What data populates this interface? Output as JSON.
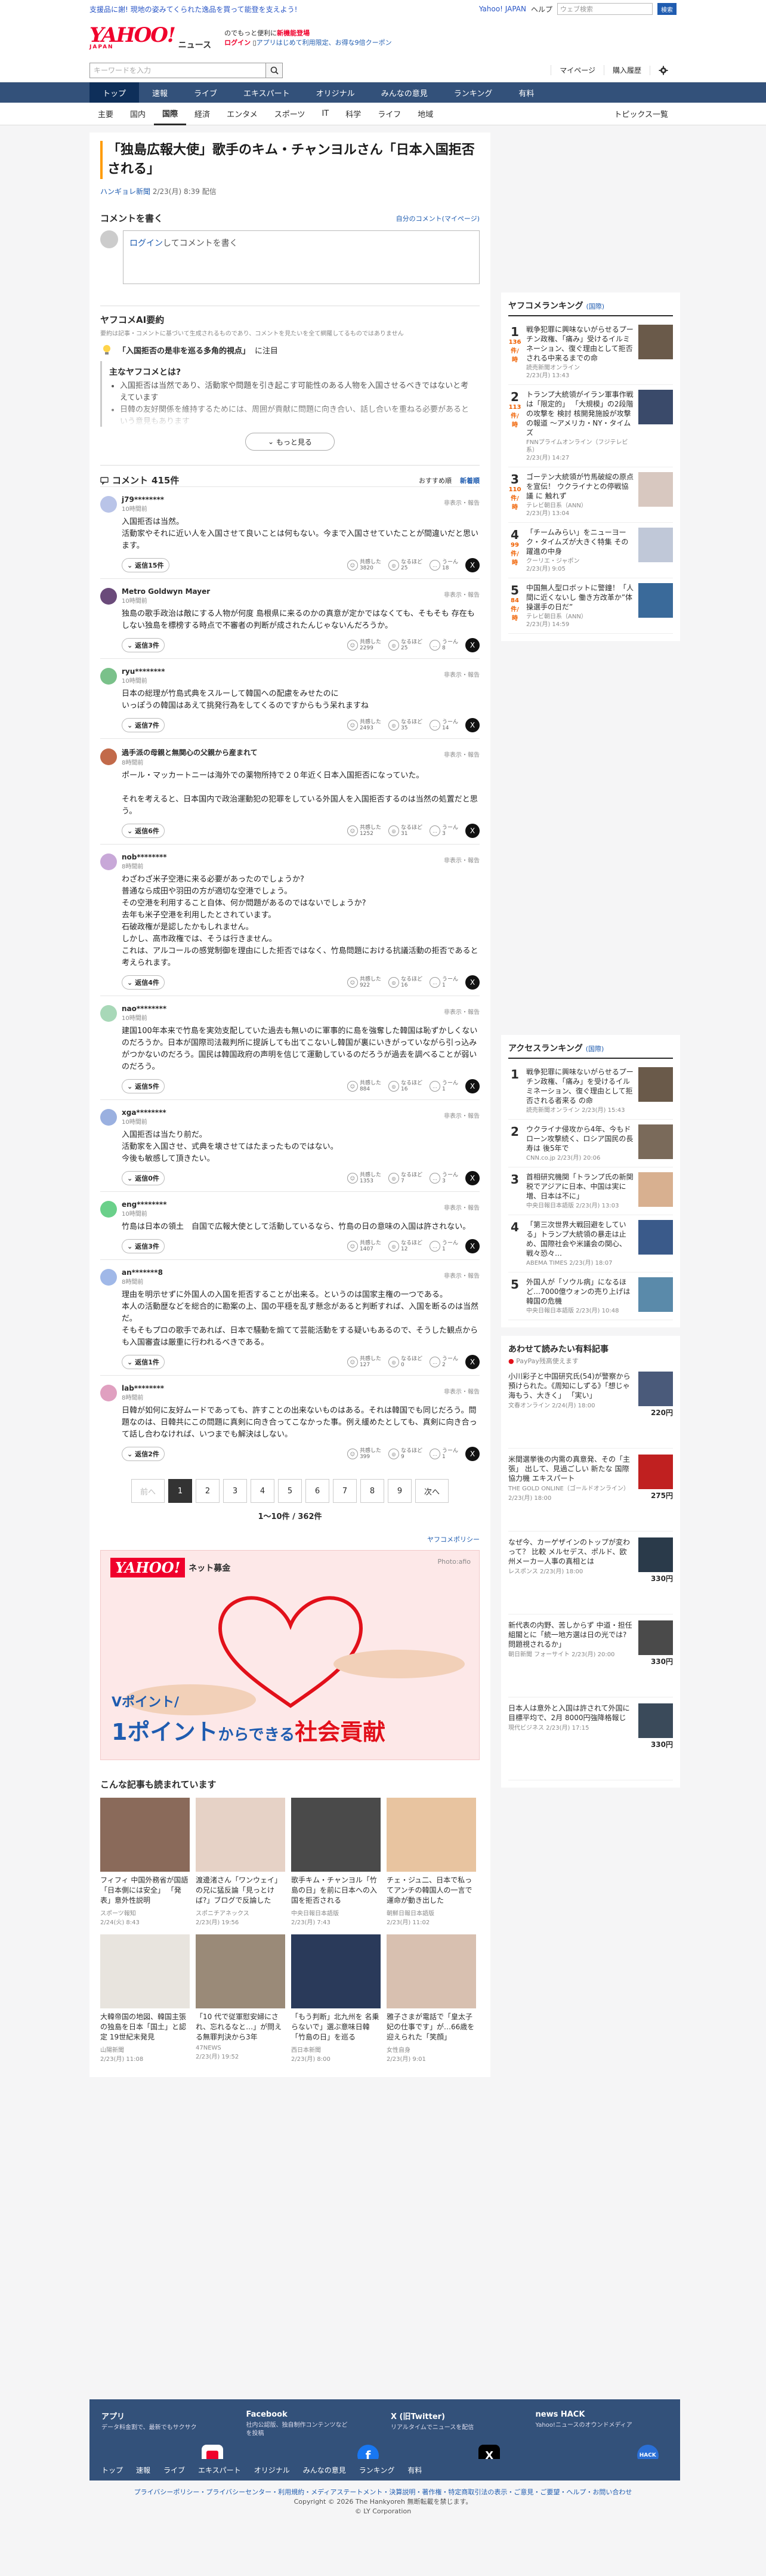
{
  "promo_bar": {
    "left": "支援品に謝! 現地の姿みてくられた逸品を買って能登を支えよう!",
    "links": [
      "Yahoo! JAPAN",
      "ヘルプ"
    ],
    "search_placeholder": "ウェブ検索",
    "search_button": "検索"
  },
  "header": {
    "logo": "YAHOO!",
    "logo_sub": "JAPAN",
    "service": "ニュース",
    "promo_line1a": "のでもっと便利に",
    "promo_line1b": "新機能登場",
    "promo_line2a": "ログイン",
    "promo_line2b": "アプリはじめて利用限定、お得な9倍クーポン"
  },
  "search": {
    "placeholder": "キーワードを入力",
    "links": [
      "マイページ",
      "購入履歴"
    ]
  },
  "gnav": [
    "トップ",
    "速報",
    "ライブ",
    "エキスパート",
    "オリジナル",
    "みんなの意見",
    "ランキング",
    "有料"
  ],
  "subnav": {
    "items": [
      "主要",
      "国内",
      "国際",
      "経済",
      "エンタメ",
      "スポーツ",
      "IT",
      "科学",
      "ライフ",
      "地域"
    ],
    "active": 2,
    "topics": "トピックス一覧"
  },
  "article": {
    "title": "「独島広報大使」歌手のキム・チャンヨルさん「日本入国拒否される」",
    "source": "ハンギョレ新聞",
    "date": "2/23(月) 8:39",
    "source_suffix": "配信"
  },
  "comment_form": {
    "title": "コメントを書く",
    "link": "自分のコメント(マイページ)",
    "login": "ログイン",
    "rest": "してコメントを書く"
  },
  "ai_summary": {
    "title": "ヤフコメAI要約",
    "note": "要約は記事・コメントに基づいて生成されるものであり、コメントを見たいを全て網羅してるものではありません",
    "topic": "「入国拒否の是非を巡る多角的視点」",
    "topic_suffix": "に注目",
    "question": "主なヤフコメとは?",
    "points": [
      "入国拒否は当然であり、活動家や問題を引き起こす可能性のある人物を入国させるべきではないと考えています",
      "日韓の友好関係を維持するためには、周囲が貢献に問題に向き合い、話し合いを重ねる必要があるという意見もあります"
    ],
    "more": "もっと見る"
  },
  "comments_header": {
    "title": "コメント",
    "count": "415件",
    "sort_recommended": "おすすめ順",
    "sort_new": "新着順"
  },
  "comments": [
    {
      "name": "j79********",
      "time": "10時間前",
      "body": "入国拒否は当然。\n活動家やそれに近い人を入国させて良いことは何もない。今まで入国させていたことが間違いだと思います。",
      "replies": "返信15件",
      "r1": "3820",
      "r2": "25",
      "r3": "18",
      "avatar": "#b9c4e8"
    },
    {
      "name": "Metro Goldwyn Mayer",
      "time": "10時間前",
      "body": "独島の歌手政治は敵にする人物が何度 島根県に来るのかの真意が定かではなくても、そもそも 存在もしない独島を標榜する時点で不審者の判断が成されたんじゃないんだろうか。",
      "replies": "返信3件",
      "r1": "2299",
      "r2": "25",
      "r3": "8",
      "avatar": "#6a4a7a"
    },
    {
      "name": "ryu********",
      "time": "10時間前",
      "body": "日本の総理が竹島式典をスルーして韓国への配慮をみせたのに\nいっぽうの韓国はあえて挑発行為をしてくるのですからもう呆れますね",
      "replies": "返信7件",
      "r1": "2493",
      "r2": "35",
      "r3": "14",
      "avatar": "#7ac18a"
    },
    {
      "name": "過手派の母親と無関心の父親から産まれて",
      "time": "8時間前",
      "body": "ポール・マッカートニーは海外での薬物所持で２０年近く日本入国拒否になっていた。\n\nそれを考えると、日本国内で政治運動犯の犯罪をしている外国人を入国拒否するのは当然の処置だと思う。",
      "replies": "返信6件",
      "r1": "1252",
      "r2": "31",
      "r3": "3",
      "avatar": "#c26a4a"
    },
    {
      "name": "nob********",
      "time": "8時間前",
      "body": "わざわざ米子空港に来る必要があったのでしょうか?\n普通なら成田や羽田の方が適切な空港でしょう。\nその空港を利用すること自体、何か問題があるのではないでしょうか?\n去年も米子空港を利用したとされています。\n石破政権が是認したかもしれません。\nしかし、高市政権では、そうは行きません。\nこれは、アルコールの感覚制御を理由にした拒否ではなく、竹島問題における抗議活動の拒否であると考えられます。",
      "replies": "返信4件",
      "r1": "922",
      "r2": "16",
      "r3": "1",
      "avatar": "#c8a8d8"
    },
    {
      "name": "nao********",
      "time": "10時間前",
      "body": "建国100年本来で竹島を実効支配していた過去も無いのに軍事的に島を強奪した韓国は恥ずかしくないのだろうか。日本が国際司法裁判所に提訴しても出てこないし韓国が裏にいきがっていながら引っ込みがつかないのだろう。国民は韓国政府の声明を信じて運動しているのだろうが過去を調べることが弱いのだろう。",
      "replies": "返信5件",
      "r1": "884",
      "r2": "16",
      "r3": "1",
      "avatar": "#a8d8b8"
    },
    {
      "name": "xga********",
      "time": "10時間前",
      "body": "入国拒否は当たり前だ。\n活動家を入国させ、式典を壊させてはたまったものではない。\n今後も敏感して頂きたい。",
      "replies": "返信0件",
      "r1": "1353",
      "r2": "7",
      "r3": "3",
      "avatar": "#9ab0e0"
    },
    {
      "name": "eng********",
      "time": "10時間前",
      "body": "竹島は日本の領土　自国で広報大使として活動しているなら、竹島の日の意味の入国は許されない。",
      "replies": "返信3件",
      "r1": "1407",
      "r2": "12",
      "r3": "1",
      "avatar": "#6ad08a"
    },
    {
      "name": "an*******8",
      "time": "8時間前",
      "body": "理由を明示せずに外国人の入国を拒否することが出来る。というのは国家主権の一つである。\n本人の活動歴などを総合的に勘案の上、国の平穏を乱す懸念があると判断すれば、入国を断るのは当然だ。\nそもそもプロの歌手であれば、日本で騒動を煽てて芸能活動をする疑いもあるので、そうした観点からも入国審査は厳重に行われるべきである。",
      "replies": "返信1件",
      "r1": "127",
      "r2": "0",
      "r3": "2",
      "avatar": "#a0b8e8"
    },
    {
      "name": "lab********",
      "time": "8時間前",
      "body": "日韓が如何に友好ムードであっても、許すことの出来ないものはある。それは韓国でも同じだろう。問題なのは、日韓共にこの問題に真剣に向き合ってこなかった事。例え緩めたとしても、真剣に向き合って話し合わなければ、いつまでも解決はしない。",
      "replies": "返信2件",
      "r1": "399",
      "r2": "9",
      "r3": "1",
      "avatar": "#e0a0c0"
    }
  ],
  "reaction_labels": {
    "r1": "共感した",
    "r2": "なるほど",
    "r3": "うーん"
  },
  "flag_label": "非表示・報告",
  "pager": {
    "prev": "前へ",
    "pages": [
      "1",
      "2",
      "3",
      "4",
      "5",
      "6",
      "7",
      "8",
      "9"
    ],
    "next": "次へ",
    "count": "1〜10件 / 362件"
  },
  "policy_link": "ヤフコメポリシー",
  "ad": {
    "logo": "YAHOO!",
    "logo_sub": "JAPAN",
    "service": "ネット募金",
    "photo": "Photo:afio",
    "copy1": "Vポイント/",
    "copy2a": "1ポイント",
    "copy2b": "からできる",
    "copy2c": "社会貢献"
  },
  "recommended": {
    "title": "こんな記事も読まれています",
    "items": [
      {
        "title": "フィフィ 中国外務省が国語「日本側には安全」 「発表」意外性説明",
        "src": "スポーツ報知",
        "date": "2/24(火) 8:43",
        "color": "#8a6a5a"
      },
      {
        "title": "渡邊渚さん「ワンウェイ」の兄に猛反論「見っとけば?」ブログで反論した",
        "src": "スポニチアネックス",
        "date": "2/23(月) 19:56",
        "color": "#e6d2c6"
      },
      {
        "title": "歌手キム・チャンヨル「竹島の日」を前に日本への入国を拒否される",
        "src": "中央日報日本語版",
        "date": "2/23(月) 7:43",
        "color": "#4a4a4a"
      },
      {
        "title": "チェ・ジュ二、日本で私ってアンチの韓国人の一言で運命が動き出した",
        "src": "朝鮮日報日本語版",
        "date": "2/23(月) 11:02",
        "color": "#e8c4a0"
      },
      {
        "title": "大韓帝国の地図、韓国主張の独島を日本「国土」と認定 19世紀末発見",
        "src": "山陽新聞",
        "date": "2/23(月) 11:08",
        "color": "#e8e4de"
      },
      {
        "title": "「10 代で従軍慰安婦にされ、忘れるなと…」が問える無罪判決から3年",
        "src": "47NEWS",
        "date": "2/23(月) 19:52",
        "color": "#9a8a78"
      },
      {
        "title": "「もう判断」北九州を 名乗らないで」選ぶ意味日韓「竹島の日」を巡る",
        "src": "西日本新聞",
        "date": "2/23(月) 8:00",
        "color": "#2a3a5a"
      },
      {
        "title": "雅子さまが電話で「皇太子妃の仕事です」が…66歳を迎えられた「笑顔」",
        "src": "女性自身",
        "date": "2/23(月) 9:01",
        "color": "#d8c0b0"
      }
    ]
  },
  "ranking": {
    "title": "ヤフコメランキング",
    "sub": "(国際)",
    "items": [
      {
        "rank": "1",
        "count": "136",
        "unit": "件/時",
        "title": "戦争犯罪に興味ないがらせるプーチン政権、「痛み」受けるイルミネーション、復ぐ理由として拒否される中来るまでの命",
        "src": "読売新聞オンライン",
        "date": "2/23(月) 13:43",
        "color": "#6a5a4a"
      },
      {
        "rank": "2",
        "count": "113",
        "unit": "件/時",
        "title": "トランプ大統領がイラン軍事作戦は「限定的」 「大規模」の2段階の攻撃を 検討 核開発施設が攻撃の報道 ～アメリカ・NY・タイムズ",
        "src": "FNNプライムオンライン（フジテレビ系）",
        "date": "2/23(月) 14:27",
        "color": "#3a4a6a"
      },
      {
        "rank": "3",
        "count": "110",
        "unit": "件/時",
        "title": "ゴーテン大統領が竹馬破綻の原点を宣伝！ ウクライナとの停戦協議 に 触れず",
        "src": "テレビ朝日系（ANN）",
        "date": "2/23(月) 13:04",
        "color": "#d8c8c0"
      },
      {
        "rank": "4",
        "count": "99",
        "unit": "件/時",
        "title": "「チームみらい」をニューヨーク・タイムズが大きく特集 その躍進の中身",
        "src": "クーリエ・ジャポン",
        "date": "2/23(月) 9:05",
        "color": "#c0c8d8"
      },
      {
        "rank": "5",
        "count": "84",
        "unit": "件/時",
        "title": "中国無人型ロボットに警鐘！「人間に近くないし 働き方改革か”体操選手の日だ”",
        "src": "テレビ朝日系（ANN）",
        "date": "2/23(月) 14:59",
        "color": "#3a6a9a"
      }
    ]
  },
  "access_ranking": {
    "title": "アクセスランキング",
    "sub": "(国際)",
    "items": [
      {
        "rank": "1",
        "title": "戦争犯罪に興味ないがらせるプーチン政権、「痛み」を受けるイルミネーション、復ぐ理由として拒否される者来る の命",
        "src": "読売新聞オンライン 2/23(月) 15:43",
        "color": "#6a5a4a"
      },
      {
        "rank": "2",
        "title": "ウクライナ侵攻から4年、今もドローン攻撃続く、ロシア国民の長寿は 後5年で",
        "src": "CNN.co.jp 2/23(月) 20:06",
        "color": "#7a6a5a"
      },
      {
        "rank": "3",
        "title": "首相研究機関「トランプ氏の新関税でアジアに日本、中国は実に増、日本は不に」",
        "src": "中央日報日本語版 2/23(月) 13:03",
        "color": "#d8b090"
      },
      {
        "rank": "4",
        "title": "「第三次世界大戦回避をしている」トランプ大統領の暴走は止め、国際社会や米議会の関心、戦々恐々…",
        "src": "ABEMA TIMES 2/23(月) 18:07",
        "color": "#3a5a8a"
      },
      {
        "rank": "5",
        "title": "外国人が「ソウル病」になるほど…7000億ウォンの売り上げは韓国の危機",
        "src": "中央日報日本語版 2/23(月) 10:48",
        "color": "#5a8aaa"
      }
    ]
  },
  "paid": {
    "title": "あわせて読みたい有料記事",
    "sub": "PayPay残高使えます",
    "items": [
      {
        "title": "小川彩子と中国研究氏(54)が警察から預けられた。《周知にしずる》「想じゃ海もう、大きく」 「実い」",
        "src": "文春オンライン 2/24(月) 18:00",
        "price": "220円",
        "color": "#4a5a7a"
      },
      {
        "title": "米間選挙後の内需の真意発、その「主張」 出して、見過ごしい 新たな 国際協力機 エキスパート",
        "src": "THE GOLD ONLINE（ゴールドオンライン） 2/23(月) 18:00",
        "price": "275円",
        "color": "#c02020"
      },
      {
        "title": "なぜ今、カーゲザインのトップが変わって？ 比較 メルセデス、ポルド、欧州メーカー人事の真相とは",
        "src": "レスポンス 2/23(月) 18:00",
        "price": "330円",
        "color": "#2a3a4a"
      },
      {
        "title": "新代表の内野、苦しからず 中道・担任組閣とに「統一地方選は日の光では? 問題視されるか」",
        "src": "朝日新聞 フォーサイト 2/23(月) 20:00",
        "price": "330円",
        "color": "#4a4a4a"
      },
      {
        "title": "日本人は意外と入国は許されて外国に 目標平均で、2月 8000円強降格報じ",
        "src": "現代ビジネス 2/23(月) 17:15",
        "price": "330円",
        "color": "#3a4a5a"
      }
    ]
  },
  "footer": {
    "blocks": [
      {
        "title": "アプリ",
        "desc": "データ料金割で、最新でもサクサク"
      },
      {
        "title": "Facebook",
        "desc": "社内公認版、独自制作コンテンツなどを投稿"
      },
      {
        "title": "X (旧Twitter)",
        "desc": "リアルタイムでニュースを配信"
      },
      {
        "title": "news HACK",
        "desc": "Yahoo!ニュースのオウンドメディア"
      }
    ],
    "nav": [
      "トップ",
      "速報",
      "ライブ",
      "エキスパート",
      "オリジナル",
      "みんなの意見",
      "ランキング",
      "有料"
    ],
    "legal": "プライバシーポリシー・プライバシーセンター・利用規約・メディアステートメント・決算説明・著作権・特定商取引法の表示・ご意見・ご要望・ヘルプ・お問い合わせ",
    "copy1": "Copyright © 2026 The Hankyoreh 無断転載を禁じます。",
    "copy2": "© LY Corporation"
  }
}
